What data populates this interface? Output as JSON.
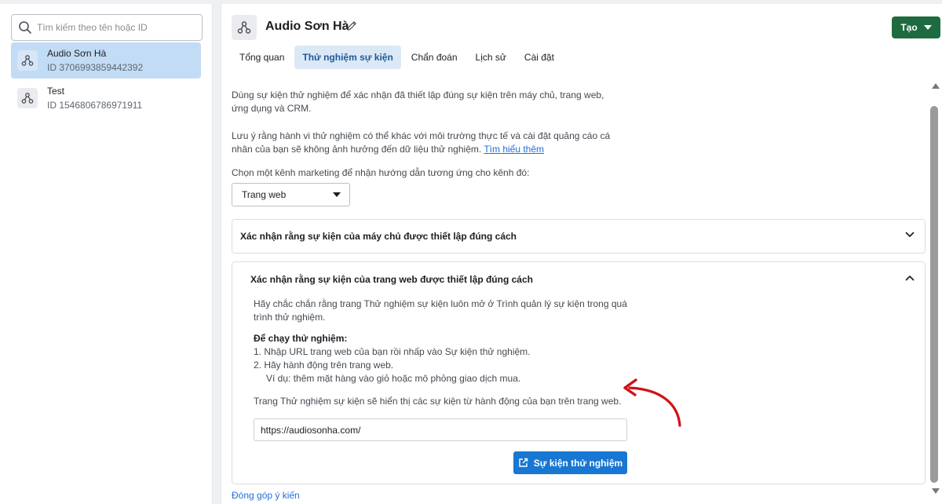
{
  "sidebar": {
    "search": {
      "placeholder": "Tìm kiếm theo tên hoặc ID",
      "value": ""
    },
    "items": [
      {
        "name": "Audio Sơn Hà",
        "id": "ID 3706993859442392",
        "selected": true
      },
      {
        "name": "Test",
        "id": "ID 1546806786971911",
        "selected": false
      }
    ]
  },
  "header": {
    "title": "Audio Sơn Hà",
    "create_label": "Tạo"
  },
  "tabs": [
    {
      "label": "Tổng quan",
      "active": false
    },
    {
      "label": "Thử nghiệm sự kiện",
      "active": true
    },
    {
      "label": "Chẩn đoán",
      "active": false
    },
    {
      "label": "Lịch sử",
      "active": false
    },
    {
      "label": "Cài đặt",
      "active": false
    }
  ],
  "content": {
    "intro_line1": "Dùng sự kiện thử nghiệm để xác nhận đã thiết lập đúng sự kiện trên máy chủ, trang web,",
    "intro_line2": "ứng dụng và CRM.",
    "note_line1": "Lưu ý rằng hành vi thử nghiệm có thể khác với môi trường thực tế và cài đặt quảng cáo cá",
    "note_line2": "nhân của bạn sẽ không ảnh hưởng đến dữ liệu thử nghiệm.",
    "learn_more": "Tìm hiểu thêm",
    "channel_prompt": "Chọn một kênh marketing để nhận hướng dẫn tương ứng cho kênh đó:",
    "channel_selected": "Trang web",
    "server_card_title": "Xác nhận rằng sự kiện của máy chủ được thiết lập đúng cách",
    "web_card": {
      "title": "Xác nhận rằng sự kiện của trang web được thiết lập đúng cách",
      "desc_line1": "Hãy chắc chắn rằng trang Thử nghiệm sự kiện luôn mở ở Trình quản lý sự kiện trong quá",
      "desc_line2": "trình thử nghiệm.",
      "run_heading": "Để chạy thử nghiệm:",
      "step1": "1.  Nhập URL trang web của bạn rồi nhấp vào Sự kiện thử nghiệm.",
      "step2": "2.  Hãy hành động trên trang web.",
      "step2_example": "Ví dụ: thêm mặt hàng vào giỏ hoặc mô phỏng giao dịch mua.",
      "result_text": "Trang Thử nghiệm sự kiện sẽ hiển thị các sự kiện từ hành động của bạn trên trang web.",
      "url_value": "https://audiosonha.com/",
      "test_button_label": "Sự kiện thử nghiệm"
    },
    "feedback_label": "Đóng góp ý kiến"
  },
  "colors": {
    "create_button": "#1e6b3f",
    "primary_button": "#1877d2",
    "selected_item": "#c2dcf5",
    "annotation_arrow": "#d0111b"
  }
}
